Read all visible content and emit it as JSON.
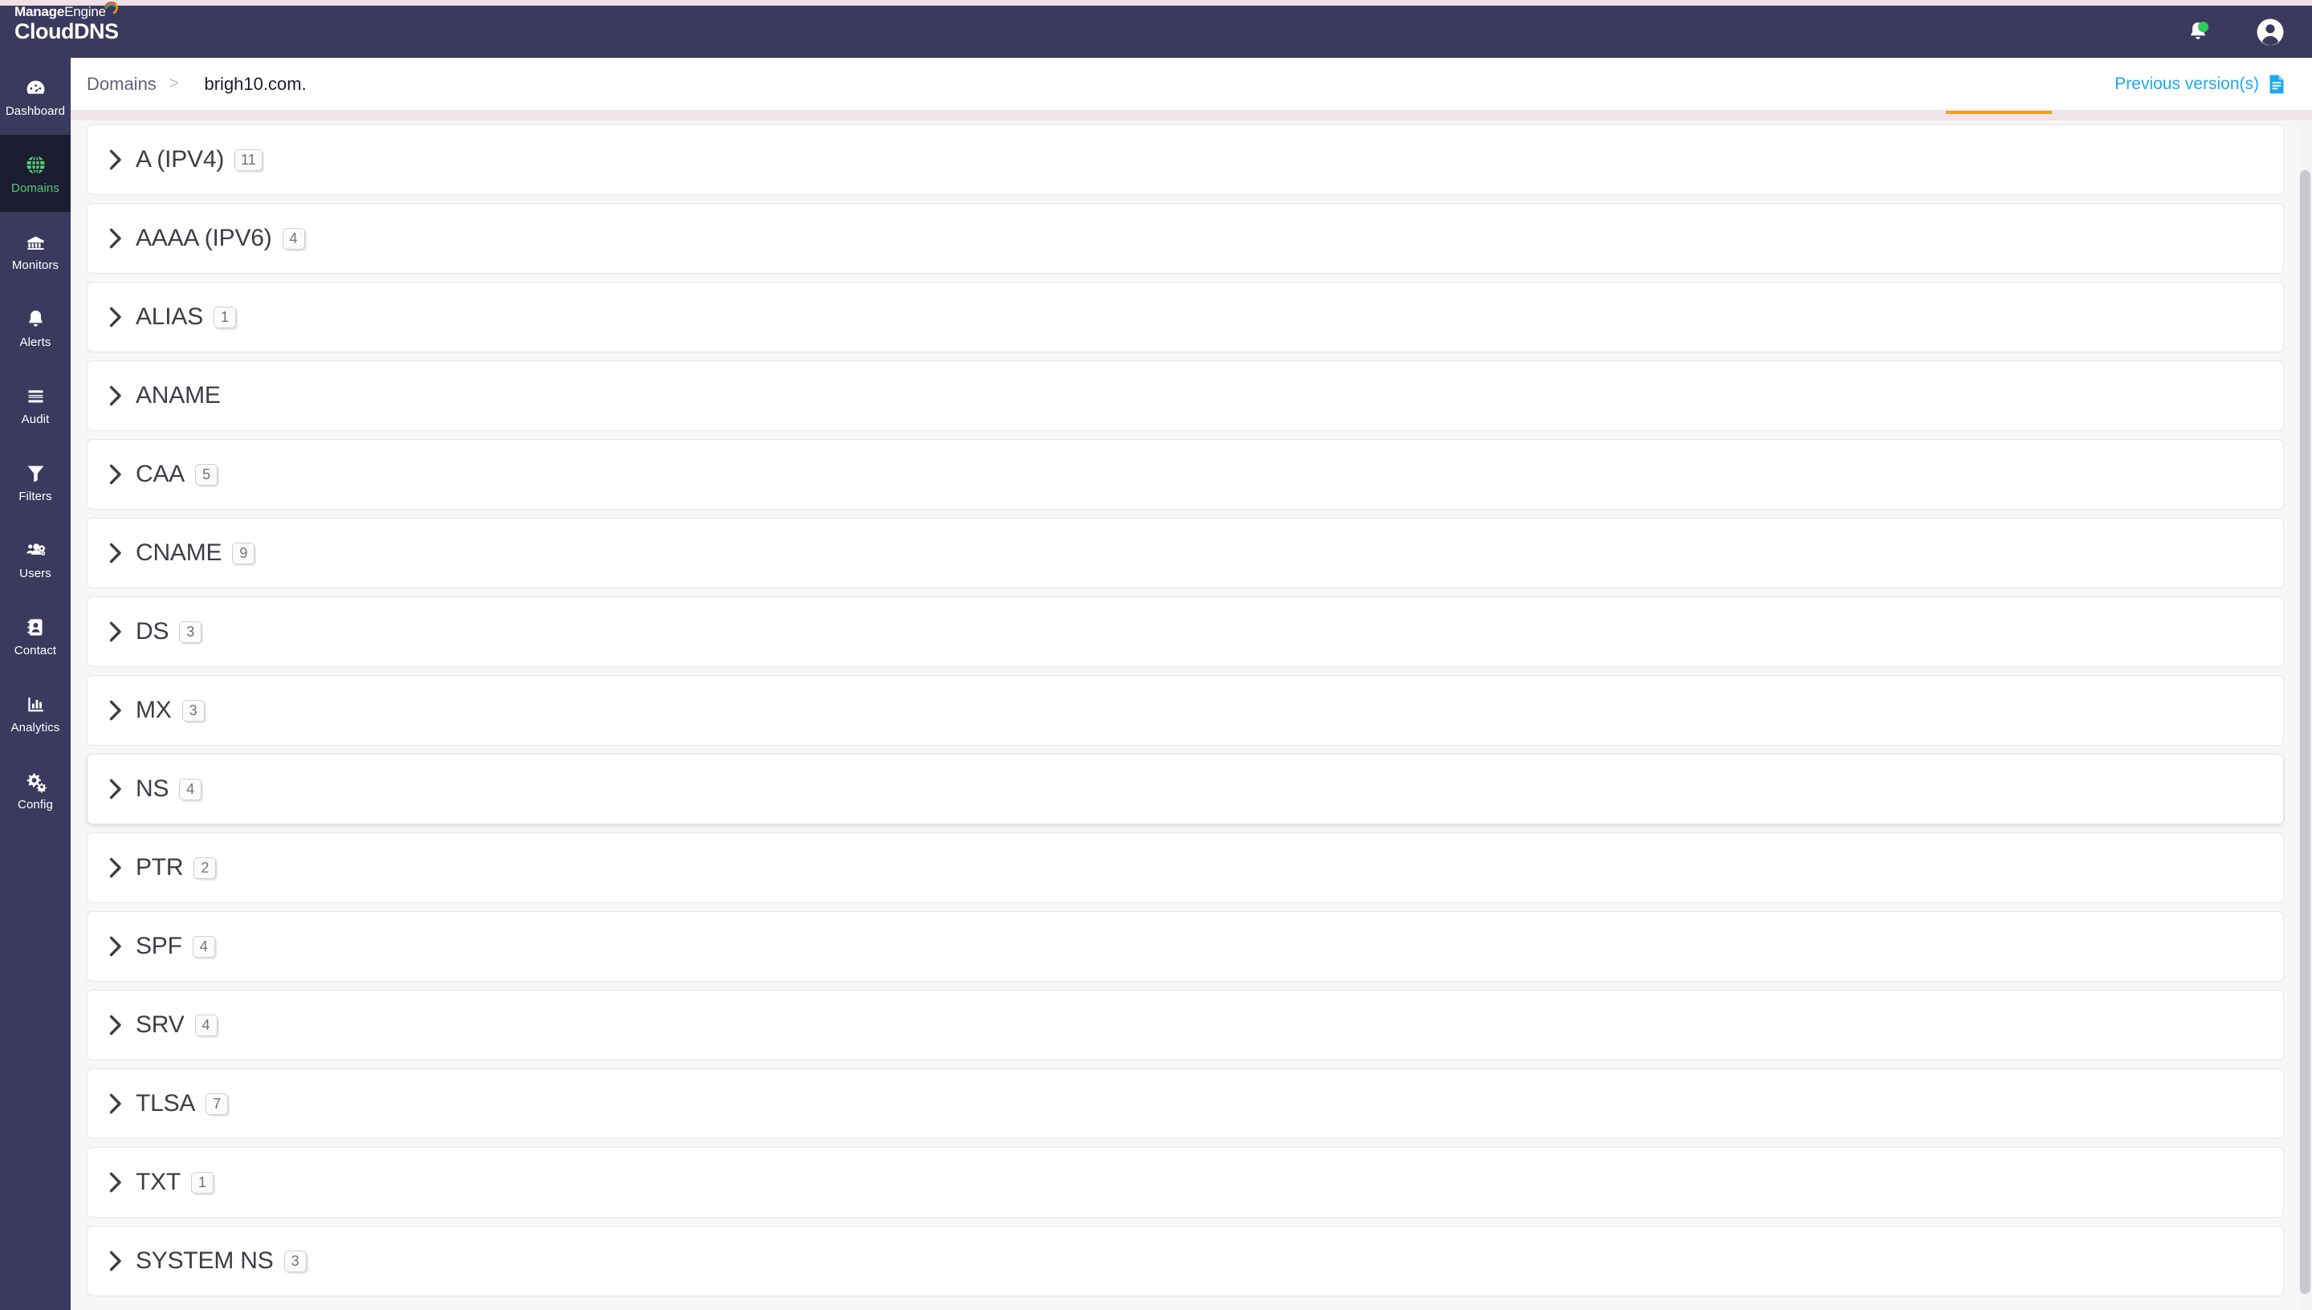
{
  "branding": {
    "top_text_manage": "Manage",
    "top_text_engine": "Engine",
    "product": "CloudDNS"
  },
  "header": {
    "notifications_icon": "bell-icon",
    "notification_dot_color": "#2ecc5b",
    "account_icon": "user-avatar-icon"
  },
  "sidebar": {
    "items": [
      {
        "label": "Dashboard",
        "icon": "gauge-icon",
        "active": false
      },
      {
        "label": "Domains",
        "icon": "globe-icon",
        "active": true
      },
      {
        "label": "Monitors",
        "icon": "server-rack-icon",
        "active": false
      },
      {
        "label": "Alerts",
        "icon": "bell-icon",
        "active": false
      },
      {
        "label": "Audit",
        "icon": "list-lines-icon",
        "active": false
      },
      {
        "label": "Filters",
        "icon": "funnel-icon",
        "active": false
      },
      {
        "label": "Users",
        "icon": "users-gear-icon",
        "active": false
      },
      {
        "label": "Contact",
        "icon": "contact-card-icon",
        "active": false
      },
      {
        "label": "Analytics",
        "icon": "bar-chart-icon",
        "active": false
      },
      {
        "label": "Config",
        "icon": "gears-icon",
        "active": false
      }
    ]
  },
  "breadcrumb": {
    "parent": "Domains",
    "separator": ">",
    "current": "brigh10.com."
  },
  "actions": {
    "previous_versions_label": "Previous version(s)",
    "previous_versions_icon": "document-icon",
    "link_color": "#1ca9f0"
  },
  "tab_indicator": {
    "color": "#e8a317"
  },
  "records": {
    "rows": [
      {
        "type": "A (IPV4)",
        "count": "11",
        "highlighted": false
      },
      {
        "type": "AAAA (IPV6)",
        "count": "4",
        "highlighted": false
      },
      {
        "type": "ALIAS",
        "count": "1",
        "highlighted": false
      },
      {
        "type": "ANAME",
        "count": "",
        "highlighted": false
      },
      {
        "type": "CAA",
        "count": "5",
        "highlighted": false
      },
      {
        "type": "CNAME",
        "count": "9",
        "highlighted": false
      },
      {
        "type": "DS",
        "count": "3",
        "highlighted": false
      },
      {
        "type": "MX",
        "count": "3",
        "highlighted": false
      },
      {
        "type": "NS",
        "count": "4",
        "highlighted": true
      },
      {
        "type": "PTR",
        "count": "2",
        "highlighted": false
      },
      {
        "type": "SPF",
        "count": "4",
        "highlighted": false
      },
      {
        "type": "SRV",
        "count": "4",
        "highlighted": false
      },
      {
        "type": "TLSA",
        "count": "7",
        "highlighted": false
      },
      {
        "type": "TXT",
        "count": "1",
        "highlighted": false
      },
      {
        "type": "SYSTEM NS",
        "count": "3",
        "highlighted": false
      }
    ]
  }
}
